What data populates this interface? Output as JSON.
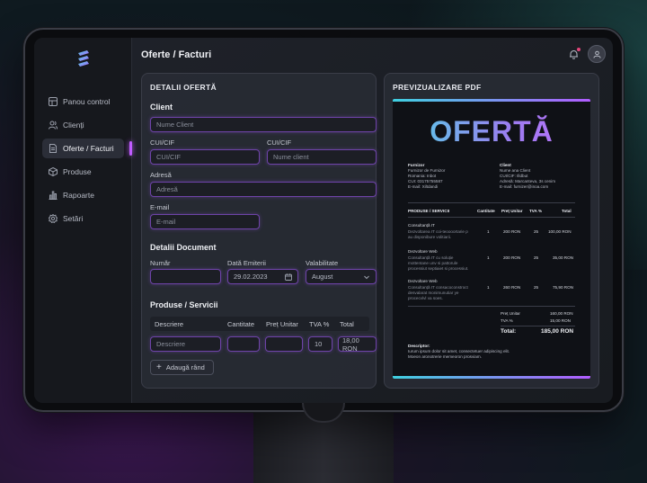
{
  "app": {
    "page_title": "Oferte / Facturi"
  },
  "sidebar": {
    "items": [
      {
        "label": "Panou control",
        "icon": "grid-icon"
      },
      {
        "label": "Clienți",
        "icon": "users-icon"
      },
      {
        "label": "Oferte / Facturi",
        "icon": "document-icon",
        "active": true
      },
      {
        "label": "Produse",
        "icon": "box-icon"
      },
      {
        "label": "Rapoarte",
        "icon": "bar-chart-icon"
      },
      {
        "label": "Setări",
        "icon": "gear-icon"
      }
    ]
  },
  "details": {
    "title": "DETALII OFERTĂ",
    "client": {
      "section": "Client",
      "name_placeholder": "Nume Client",
      "cui_label": "CUI/CIF",
      "cui_placeholder": "CUI/CIF",
      "cui2_label": "CUI/CIF",
      "cui2_placeholder": "Nume client",
      "address_label": "Adresă",
      "address_placeholder": "Adresă",
      "email_label": "E-mail",
      "email_placeholder": "E-mail"
    },
    "document": {
      "section": "Detalii Document",
      "number_label": "Număr",
      "number_value": "",
      "date_label": "Dată Emiterii",
      "date_value": "29.02.2023",
      "validity_label": "Valabilitate",
      "validity_value": "August"
    },
    "products": {
      "section": "Produse / Servicii",
      "columns": [
        "Descriere",
        "Cantitate",
        "Preț Unitar",
        "TVA %",
        "Total"
      ],
      "row": {
        "description_placeholder": "Descriere",
        "quantity": "",
        "unit_price": "",
        "vat": "10",
        "total": "18,00 RON"
      },
      "add_label": "Adaugă rând"
    }
  },
  "preview": {
    "title": "PREVIZUALIZARE PDF",
    "pdf": {
      "heading": "OFERTĂ",
      "supplier": {
        "label": "Furnizor",
        "lines": [
          "Furnizor de Furnizor",
          "Romania: Inbot",
          "CUI: 03175755587",
          "E-mail: Xiltdandi"
        ]
      },
      "client": {
        "label": "Client",
        "lines": [
          "Nume ana Client",
          "CUI/CIF: Illdbut",
          "Adresă: Marcanteva, 3s cenim",
          "E-mail: furnizer@inoa.com"
        ]
      },
      "columns": [
        "PRODUSE / SERVICII",
        "Cantitate",
        "Preț Unitar",
        "TVA %",
        "Total"
      ],
      "rows": [
        {
          "name": "Consultanță IT",
          "desc": [
            "Dezvoltarea IT coi-teoooortarie p",
            "au disponibure volitiarii."
          ],
          "qty": "1",
          "price": "200 RON",
          "vat": "25",
          "total": "100,00 RON"
        },
        {
          "name": "Dezvoltare Web",
          "desc": [
            "Consultanță IT cu soluție",
            "mottentane unv si pattorule",
            "processiut septiaiet si processiut."
          ],
          "qty": "1",
          "price": "200 RON",
          "vat": "25",
          "total": "35,00 RON"
        },
        {
          "name": "Dezvoltare Web",
          "desc": [
            "Consultanță IT consacoconstroct",
            "desvalarat monimunutiar ye",
            "procecvlvl va soes."
          ],
          "qty": "1",
          "price": "260 RON",
          "vat": "25",
          "total": "75,90 RON"
        }
      ],
      "summary": [
        {
          "label": "Preț Unitar",
          "value": "160,00 RON"
        },
        {
          "label": "TVA %",
          "value": "15,00 RON"
        }
      ],
      "total_label": "Total:",
      "total_value": "185,00 RON",
      "description_label": "Descriptor:",
      "description_lines": [
        "Iurum ipsum dolor sit amet, consectetuer adipiscing elit.",
        "Moeon aronotrerie memeoron prosviam."
      ]
    }
  },
  "colors": {
    "accent_purple": "#b15cff",
    "accent_cyan": "#3fd0e0",
    "notification_dot": "#e2457a"
  }
}
